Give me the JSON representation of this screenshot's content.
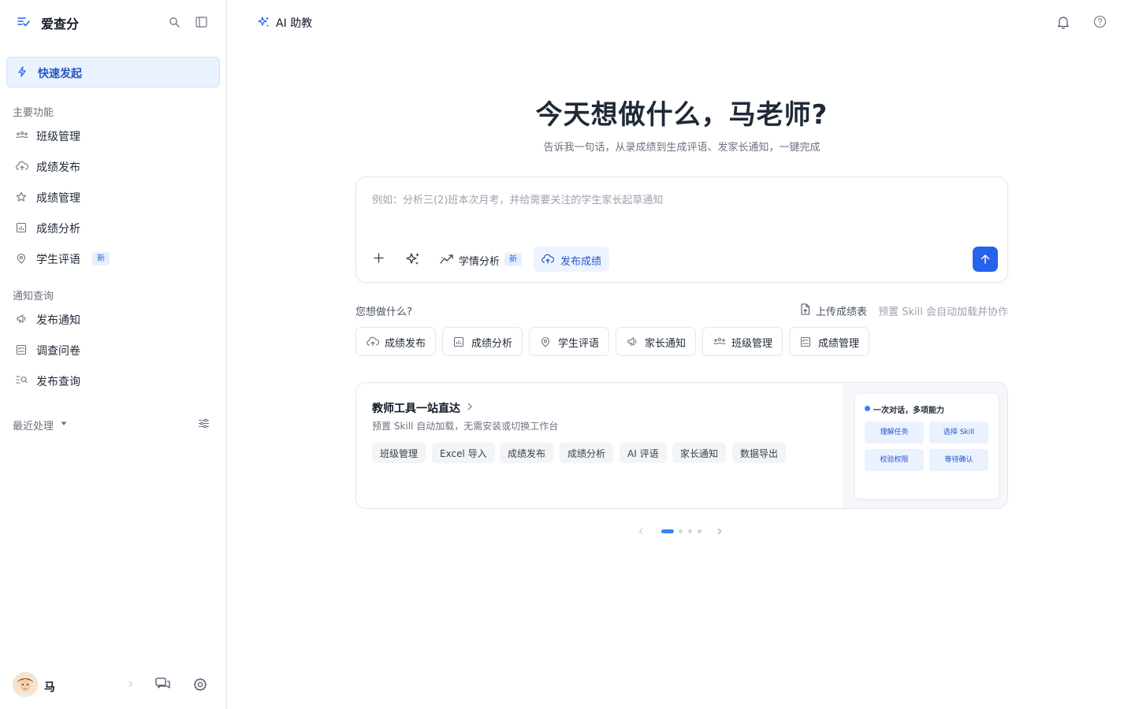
{
  "app": {
    "name": "爱查分"
  },
  "sidebar": {
    "quick_launch": "快速发起",
    "section_main": "主要功能",
    "main_items": [
      {
        "label": "班级管理",
        "icon": "class-group-icon"
      },
      {
        "label": "成绩发布",
        "icon": "cloud-upload-icon"
      },
      {
        "label": "成绩管理",
        "icon": "star-icon"
      },
      {
        "label": "成绩分析",
        "icon": "chart-box-icon"
      },
      {
        "label": "学生评语",
        "icon": "pin-comment-icon",
        "badge": "新"
      }
    ],
    "section_notice": "通知查询",
    "notice_items": [
      {
        "label": "发布通知",
        "icon": "megaphone-icon"
      },
      {
        "label": "调查问卷",
        "icon": "survey-icon"
      },
      {
        "label": "发布查询",
        "icon": "search-list-icon"
      }
    ],
    "recent": "最近处理",
    "user": {
      "name": "马"
    }
  },
  "header": {
    "title": "AI 助教"
  },
  "hero": {
    "title": "今天想做什么，马老师?",
    "subtitle": "告诉我一句话，从录成绩到生成评语、发家长通知，一键完成"
  },
  "composer": {
    "placeholder": "例如：分析三(2)班本次月考，并给需要关注的学生家长起草通知",
    "value": "",
    "chip_analysis": "学情分析",
    "chip_analysis_badge": "新",
    "chip_publish": "发布成绩"
  },
  "suggestions": {
    "label": "您想做什么?",
    "upload": "上传成绩表",
    "preset_note": "预置 Skill 会自动加载并协作",
    "buttons": [
      {
        "label": "成绩发布",
        "icon": "cloud-upload-icon"
      },
      {
        "label": "成绩分析",
        "icon": "chart-box-icon"
      },
      {
        "label": "学生评语",
        "icon": "pin-comment-icon"
      },
      {
        "label": "家长通知",
        "icon": "megaphone-icon"
      },
      {
        "label": "班级管理",
        "icon": "class-group-icon"
      },
      {
        "label": "成绩管理",
        "icon": "survey-icon"
      }
    ]
  },
  "card": {
    "title": "教师工具一站直达",
    "desc": "预置 Skill 自动加载，无需安装或切换工作台",
    "tags": [
      "班级管理",
      "Excel 导入",
      "成绩发布",
      "成绩分析",
      "AI 评语",
      "家长通知",
      "数据导出"
    ],
    "preview": {
      "title": "一次对话，多项能力",
      "tiles": [
        "理解任务",
        "选择 Skill",
        "校验权限",
        "等待确认"
      ]
    }
  },
  "pager": {
    "total": 4,
    "current": 1
  },
  "colors": {
    "accent": "#2563eb",
    "accent_bg": "#eaf2ff"
  }
}
